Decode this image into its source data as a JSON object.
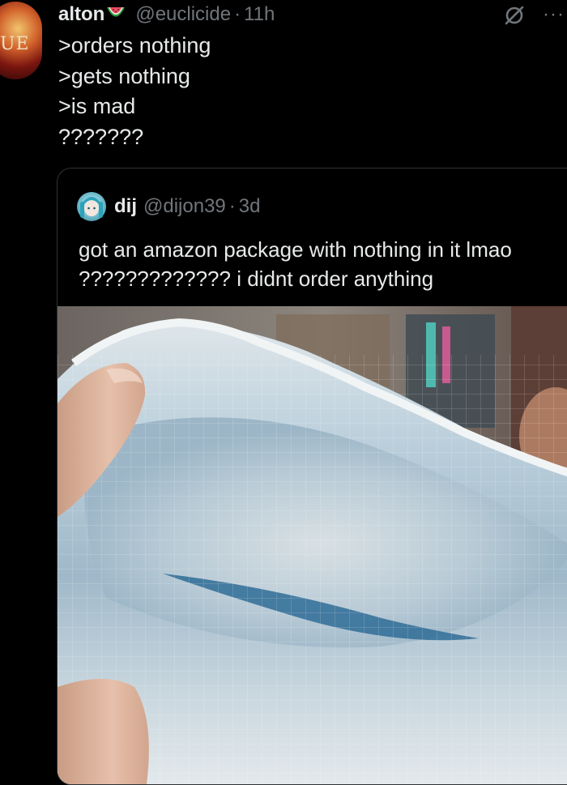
{
  "tweet": {
    "author_name": "alton",
    "author_emoji_icon": "watermelon-icon",
    "handle": "@euclicide",
    "separator": "·",
    "time": "11h",
    "avatar_text": "UE",
    "lines": [
      ">orders nothing",
      ">gets nothing",
      ">is mad",
      "???????"
    ]
  },
  "actions": {
    "grok_icon": "grok-icon",
    "more_label": "···"
  },
  "quote": {
    "author_name": "dij",
    "handle": "@dijon39",
    "separator": "·",
    "time": "3d",
    "text": "got an amazon package with nothing in it lmao ????????????? i didnt order anything",
    "photo_icon": "bubble-mailer-photo"
  },
  "colors": {
    "background": "#000000",
    "text_primary": "#e7e9ea",
    "text_secondary": "#71767b",
    "border": "#2f3336"
  }
}
